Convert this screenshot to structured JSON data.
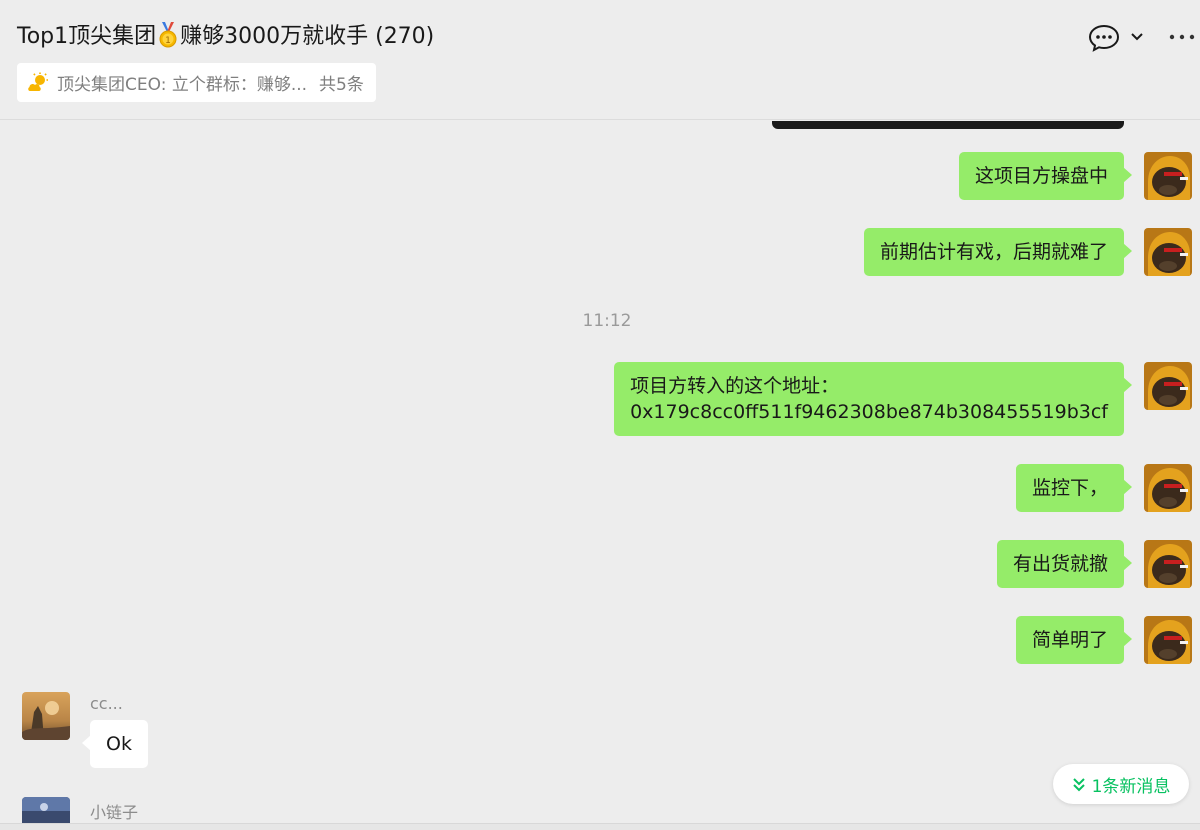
{
  "header": {
    "title_before": "Top1顶尖集团",
    "title_after": "赚够3000万就收手 (270)",
    "medal_icon": "first-place-medal-icon",
    "chat_icon": "chat-bubble-icon",
    "dropdown_icon": "chevron-down-icon",
    "more_icon": "more-dots-icon"
  },
  "pinned": {
    "icon": "sunny-weather-icon",
    "text": "顶尖集团CEO: 立个群标：赚够...",
    "count": "共5条"
  },
  "messages": {
    "m1": "这项目方操盘中",
    "m2": "前期估计有戏，后期就难了",
    "timestamp": "11:12",
    "m3_line1": "项目方转入的这个地址：",
    "m3_line2": "0x179c8cc0ff511f9462308be874b308455519b3cf",
    "m4": "监控下，",
    "m5": "有出货就撤",
    "m6": "简单明了",
    "other1_sender": "cc...",
    "other1_text": "Ok",
    "other2_sender": "小链子"
  },
  "new_messages": {
    "icon": "double-chevron-down-icon",
    "label": "1条新消息"
  },
  "colors": {
    "background": "#ededed",
    "my_bubble": "#95ec69",
    "other_bubble": "#ffffff",
    "accent_green": "#07c160"
  }
}
